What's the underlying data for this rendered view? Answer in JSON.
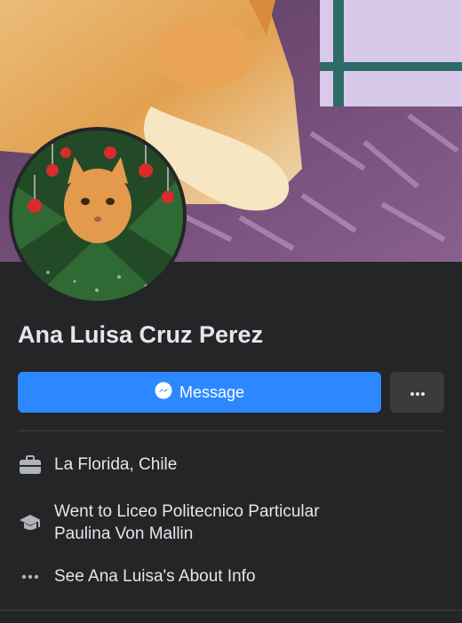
{
  "profile": {
    "name": "Ana Luisa Cruz Perez"
  },
  "actions": {
    "message_label": "Message",
    "more_label": "···"
  },
  "info": [
    {
      "icon": "briefcase-icon",
      "text": "La Florida, Chile"
    },
    {
      "icon": "graduation-cap-icon",
      "text": "Went to Liceo Politecnico Particular\nPaulina Von Mallin"
    },
    {
      "icon": "more-dots-icon",
      "text": "See Ana Luisa's About Info"
    }
  ],
  "colors": {
    "background": "#242526",
    "primary_button": "#2d88ff",
    "secondary_button": "#3a3b3c",
    "text": "#e4e6eb",
    "icon": "#b0b3b8"
  }
}
